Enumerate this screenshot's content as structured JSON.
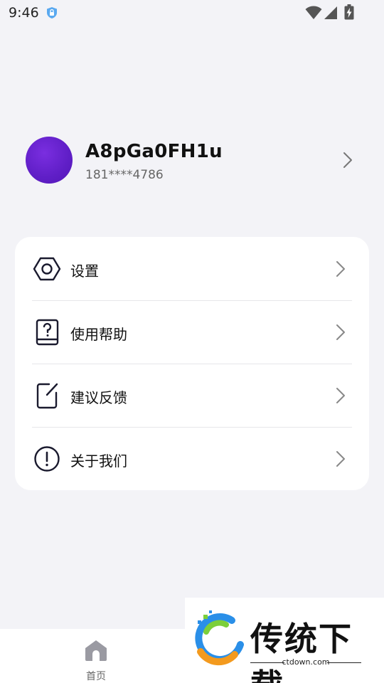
{
  "status_bar": {
    "time": "9:46"
  },
  "profile": {
    "username": "A8pGa0FH1u",
    "phone": "181****4786",
    "avatar_color": "#5f1ec6"
  },
  "menu": {
    "items": [
      {
        "label": "设置",
        "icon": "settings-hexagon-icon"
      },
      {
        "label": "使用帮助",
        "icon": "help-book-icon"
      },
      {
        "label": "建议反馈",
        "icon": "edit-feedback-icon"
      },
      {
        "label": "关于我们",
        "icon": "info-exclamation-icon"
      }
    ]
  },
  "bottom_nav": {
    "home_label": "首页"
  },
  "watermark": {
    "title": "传统下载",
    "domain": "ctdown.com"
  }
}
